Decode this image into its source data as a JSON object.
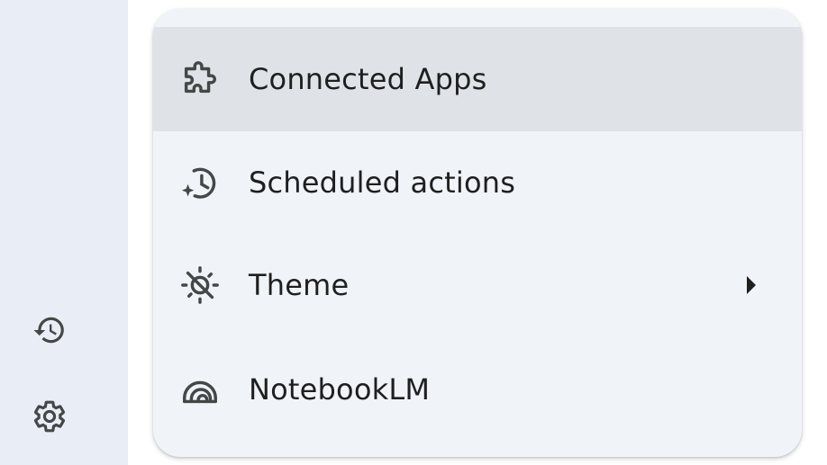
{
  "sidebar": {
    "buttons": [
      {
        "name": "history",
        "icon": "history-icon"
      },
      {
        "name": "settings",
        "icon": "gear-icon"
      }
    ]
  },
  "menu": {
    "items": [
      {
        "label": "Connected Apps",
        "icon": "puzzle-icon",
        "active": true
      },
      {
        "label": "Scheduled actions",
        "icon": "scheduled-clock-icon"
      },
      {
        "label": "Theme",
        "icon": "theme-icon",
        "has_submenu": true
      },
      {
        "label": "NotebookLM",
        "icon": "notebooklm-icon"
      }
    ]
  },
  "colors": {
    "rail_bg": "#e9eef6",
    "menu_bg": "#f0f4f9",
    "active_bg": "#dfe3e8",
    "icon": "#444746",
    "text": "#1f1f1f"
  }
}
